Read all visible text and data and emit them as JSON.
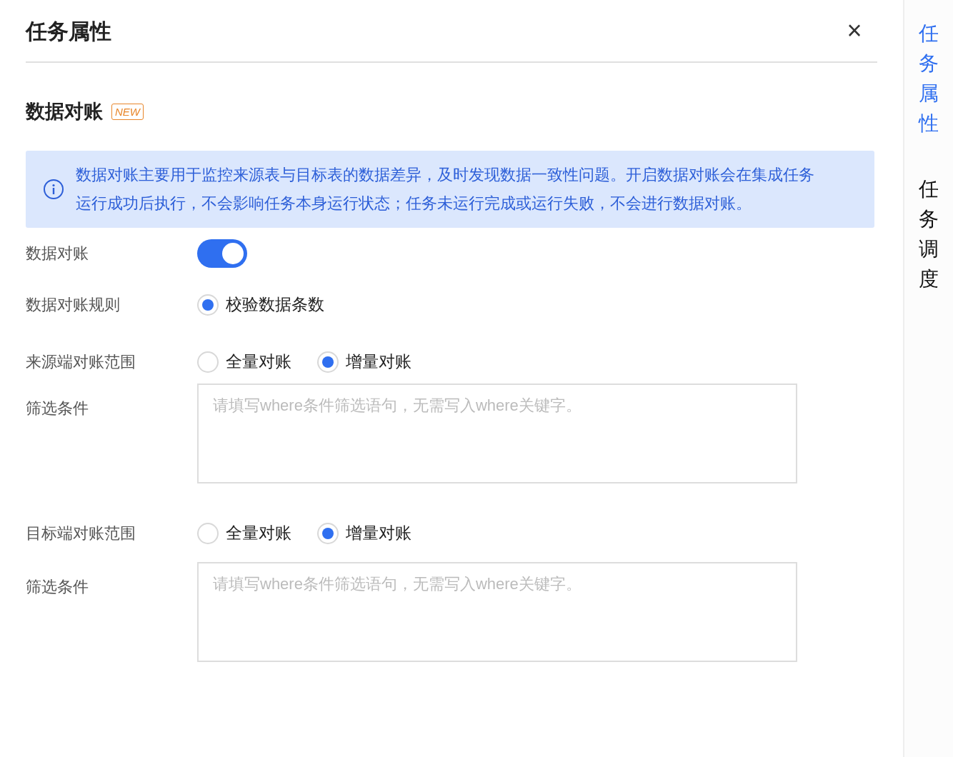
{
  "panel": {
    "title": "任务属性",
    "close": "×"
  },
  "section": {
    "title": "数据对账",
    "badge": "NEW"
  },
  "info": {
    "text": "数据对账主要用于监控来源表与目标表的数据差异，及时发现数据一致性问题。开启数据对账会在集成任务运行成功后执行，不会影响任务本身运行状态；任务未运行完成或运行失败，不会进行数据对账。"
  },
  "form": [
    {
      "kind": "switch",
      "label": "数据对账",
      "on": true
    },
    {
      "kind": "radio",
      "label": "数据对账规则",
      "options": [
        {
          "label": "校验数据条数",
          "selected": true
        }
      ]
    },
    {
      "kind": "radio",
      "label": "来源端对账范围",
      "options": [
        {
          "label": "全量对账",
          "selected": false
        },
        {
          "label": "增量对账",
          "selected": true
        }
      ]
    },
    {
      "kind": "textarea",
      "label": "筛选条件",
      "placeholder": "请填写where条件筛选语句，无需写入where关键字。"
    },
    {
      "kind": "radio",
      "label": "目标端对账范围",
      "options": [
        {
          "label": "全量对账",
          "selected": false
        },
        {
          "label": "增量对账",
          "selected": true
        }
      ]
    },
    {
      "kind": "textarea",
      "label": "筛选条件",
      "placeholder": "请填写where条件筛选语句，无需写入where关键字。"
    }
  ],
  "side_tabs": [
    {
      "label": "任务属性",
      "selected": true
    },
    {
      "label": "任务调度",
      "selected": false
    }
  ]
}
